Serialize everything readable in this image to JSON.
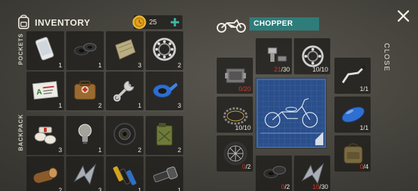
{
  "inventory": {
    "title": "INVENTORY",
    "coins": "25",
    "sections": {
      "pockets": "POCKETS",
      "backpack": "BACKPACK"
    },
    "pockets": [
      {
        "name": "phone",
        "count": "1"
      },
      {
        "name": "tape-roll",
        "count": "1"
      },
      {
        "name": "cloth",
        "count": "3"
      },
      {
        "name": "bearing",
        "count": "2"
      },
      {
        "name": "id-card",
        "count": "1"
      },
      {
        "name": "first-aid-kit",
        "count": "2"
      },
      {
        "name": "wrench",
        "count": "1"
      },
      {
        "name": "blue-tape",
        "count": "3"
      }
    ],
    "backpack": [
      {
        "name": "bandages",
        "count": "3"
      },
      {
        "name": "light-bulb",
        "count": "1"
      },
      {
        "name": "tire",
        "count": "2"
      },
      {
        "name": "jerrycan",
        "count": "2"
      },
      {
        "name": "log",
        "count": "2"
      },
      {
        "name": "scrap-metal",
        "count": "3"
      },
      {
        "name": "batteries",
        "count": "1"
      },
      {
        "name": "flashlight",
        "count": "1"
      }
    ]
  },
  "chopper": {
    "name": "CHOPPER",
    "parts": [
      {
        "name": "bolt",
        "have": "21",
        "need": "30",
        "short": true
      },
      {
        "name": "bearing",
        "have": "10",
        "need": "10",
        "short": false
      },
      {
        "name": "engine",
        "have": "0",
        "need": "20",
        "short": true
      },
      {
        "name": "handlebar",
        "have": "1",
        "need": "1",
        "short": false
      },
      {
        "name": "chain",
        "have": "10",
        "need": "10",
        "short": false
      },
      {
        "name": "fuel-tank",
        "have": "1",
        "need": "1",
        "short": false
      },
      {
        "name": "wheel",
        "have": "0",
        "need": "2",
        "short": true
      },
      {
        "name": "leather-bag",
        "have": "0",
        "need": "4",
        "short": true
      },
      {
        "name": "tape",
        "have": "0",
        "need": "2",
        "short": true
      },
      {
        "name": "scrap",
        "have": "10",
        "need": "30",
        "short": true
      }
    ]
  },
  "close_label": "CLOSE",
  "colors": {
    "accent": "#2e7d7a",
    "warn": "#d23a2a",
    "panel": "#1c1b18"
  }
}
